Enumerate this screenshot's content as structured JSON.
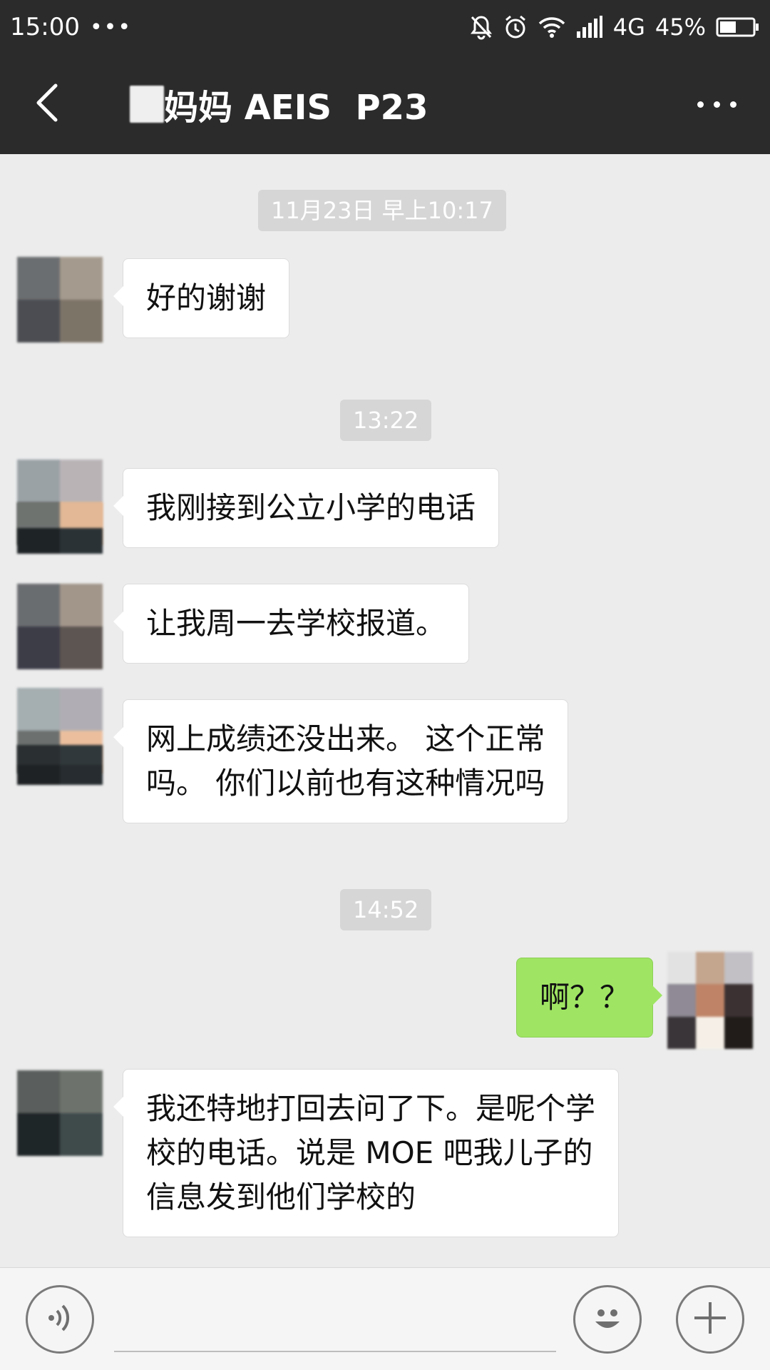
{
  "status_bar": {
    "time": "15:00",
    "dots": "•••",
    "network": "4G",
    "battery": "45%",
    "icons": [
      "mute-bell-icon",
      "alarm-icon",
      "wifi-icon",
      "signal-icon",
      "battery-icon"
    ]
  },
  "header": {
    "title": "妈妈 AEIS  P23",
    "back_icon": "back-chevron-icon",
    "more_icon": "more-dots-icon",
    "background": "#2b2b2b"
  },
  "timestamps": [
    "11月23日 早上10:17",
    "13:22",
    "14:52"
  ],
  "messages": [
    {
      "side": "left",
      "text": "好的谢谢"
    },
    {
      "side": "left",
      "text": "我刚接到公立小学的电话"
    },
    {
      "side": "left",
      "text": "让我周一去学校报道。"
    },
    {
      "side": "left",
      "line1": "网上成绩还没出来。 这个正常",
      "line2": "吗。 你们以前也有这种情况吗"
    },
    {
      "side": "right",
      "text": "啊？？"
    },
    {
      "side": "left",
      "line1": "我还特地打回去问了下。是呢个学",
      "line2": "校的电话。说是 MOE 吧我儿子的",
      "line3": "信息发到他们学校的"
    }
  ],
  "colors": {
    "chat_background": "#ececec",
    "incoming_bubble": "#ffffff",
    "outgoing_bubble": "#9fe563"
  },
  "input_bar": {
    "voice_icon": "voice-icon",
    "emoji_icon": "emoji-icon",
    "plus_icon": "plus-icon",
    "placeholder": ""
  }
}
